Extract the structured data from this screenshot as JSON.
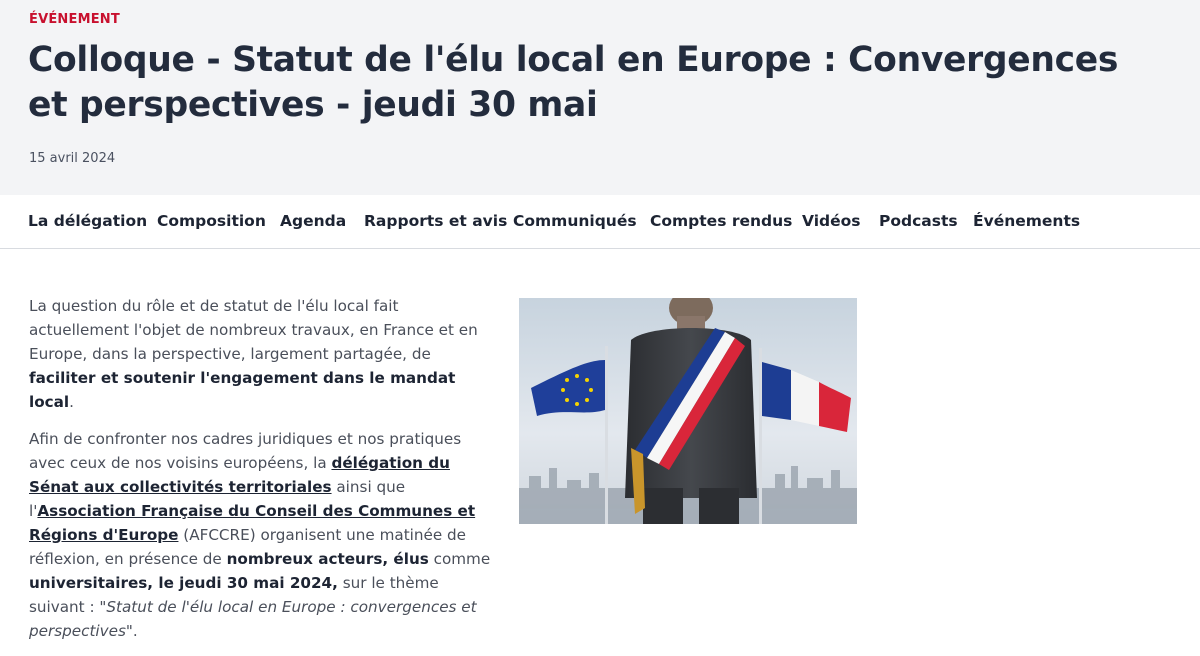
{
  "header": {
    "kicker": "ÉVÉNEMENT",
    "title": "Colloque - Statut de l'élu local en Europe : Convergences et perspectives - jeudi 30 mai",
    "date": "15 avril 2024"
  },
  "nav": {
    "items": [
      {
        "label": "La délégation"
      },
      {
        "label": "Composition"
      },
      {
        "label": "Agenda"
      },
      {
        "label": "Rapports et avis"
      },
      {
        "label": "Communiqués"
      },
      {
        "label": "Comptes rendus"
      },
      {
        "label": "Vidéos"
      },
      {
        "label": "Podcasts"
      },
      {
        "label": "Événements"
      }
    ]
  },
  "content": {
    "p1": {
      "t1": "La question du rôle et de statut de l'élu local fait actuellement l'objet de nombreux travaux, en France et en Europe, dans la perspective, largement partagée, de ",
      "b1": "faciliter et soutenir l'engagement dans le mandat local",
      "t2": "."
    },
    "p2": {
      "t1": "Afin de confronter nos cadres juridiques et nos pratiques avec ceux de nos voisins européens, la ",
      "link1": "délégation du Sénat aux collectivités territoriales",
      "t2": " ainsi que l'",
      "link2": "Association Française du Conseil des Communes et Régions d'Europe",
      "t3": " (AFCCRE) organisent une matinée de réflexion, en présence de ",
      "b1": "nombreux acteurs, élus",
      "t4": " comme ",
      "b2": "universitaires, le jeudi 30 mai 2024,",
      "t5": " sur le thème suivant : ",
      "i1": "\"Statut de l'élu local en Europe : convergences et perspectives\"",
      "t6": "."
    }
  },
  "colors": {
    "kicker": "#c8102e",
    "hero_bg": "#f3f4f6",
    "title": "#232c3d",
    "eu_blue": "#1f3f9a",
    "eu_star": "#f5d300",
    "fr_blue": "#1d3d93",
    "fr_red": "#d9263a"
  },
  "image": {
    "icon": "mayor-sash-flags-photo"
  }
}
